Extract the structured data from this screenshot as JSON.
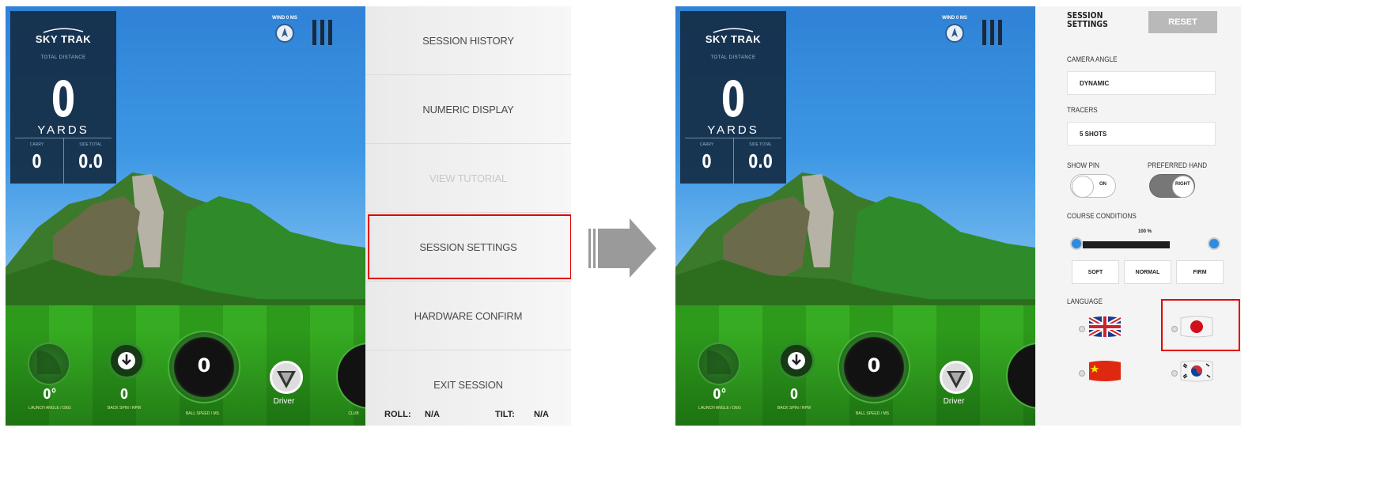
{
  "left": {
    "card": {
      "logo": "SKY TRAK",
      "total_label": "TOTAL DISTANCE",
      "total_value": "0",
      "unit": "YARDS",
      "carry_label": "CARRY",
      "carry_value": "0",
      "side_label": "SIDE TOTAL",
      "side_value": "0.0"
    },
    "wind_label": "WIND 0 MS",
    "hud": {
      "launch_value": "0°",
      "launch_label": "LAUNCH ANGLE / DEG",
      "spin_value": "0",
      "spin_label": "BACK SPIN / RPM",
      "speed_value": "0",
      "speed_label": "BALL SPEED / MS",
      "club_label": "Driver",
      "club_speed_label": "CLUB"
    },
    "menu": {
      "items": [
        {
          "label": "SESSION HISTORY"
        },
        {
          "label": "NUMERIC DISPLAY"
        },
        {
          "label": "VIEW TUTORIAL"
        },
        {
          "label": "SESSION SETTINGS"
        },
        {
          "label": "HARDWARE CONFIRM"
        },
        {
          "label": "EXIT SESSION"
        }
      ],
      "roll_label": "ROLL:",
      "roll_value": "N/A",
      "tilt_label": "TILT:",
      "tilt_value": "N/A"
    }
  },
  "right": {
    "card": {
      "logo": "SKY TRAK",
      "total_label": "TOTAL DISTANCE",
      "total_value": "0",
      "unit": "YARDS",
      "carry_label": "CARRY",
      "carry_value": "0",
      "side_label": "SIDE TOTAL",
      "side_value": "0.0"
    },
    "wind_label": "WIND 0 MS",
    "hud": {
      "launch_value": "0°",
      "launch_label": "LAUNCH ANGLE / DEG",
      "spin_value": "0",
      "spin_label": "BACK SPIN / RPM",
      "speed_value": "0",
      "speed_label": "BALL SPEED / MS",
      "club_label": "Driver"
    },
    "settings": {
      "title_line1": "SESSION",
      "title_line2": "SETTINGS",
      "reset_label": "RESET",
      "camera_label": "CAMERA ANGLE",
      "camera_value": "DYNAMIC",
      "tracers_label": "TRACERS",
      "tracers_value": "5 SHOTS",
      "show_pin_label": "SHOW PIN",
      "show_pin_value": "ON",
      "hand_label": "PREFERRED HAND",
      "hand_value": "RIGHT",
      "conditions_label": "COURSE CONDITIONS",
      "conditions_value": "100 %",
      "conditions_level": 1.0,
      "cond_soft": "SOFT",
      "cond_normal": "NORMAL",
      "cond_firm": "FIRM",
      "language_label": "LANGUAGE"
    }
  },
  "colors": {
    "highlight": "#e00000",
    "card_bg": "#142d46",
    "accent_blue": "#2f8be0"
  }
}
